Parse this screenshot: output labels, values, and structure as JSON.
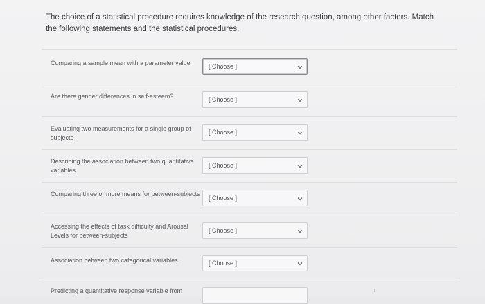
{
  "question": {
    "prompt": "The choice of a statistical procedure requires knowledge of the research question, among other factors. Match the following statements and the statistical procedures."
  },
  "rows": [
    {
      "label": "Comparing a sample mean with a parameter value",
      "value": "[ Choose ]"
    },
    {
      "label": "Are there gender differences in self-esteem?",
      "value": "[ Choose ]"
    },
    {
      "label": "Evaluating two measurements for a single group of subjects",
      "value": "[ Choose ]"
    },
    {
      "label": "Describing the association between two quantitative variables",
      "value": "[ Choose ]"
    },
    {
      "label": "Comparing three or more means for between-subjects",
      "value": "[ Choose ]"
    },
    {
      "label": "Accessing the effects of task difficulty and Arousal Levels for between-subjects",
      "value": "[ Choose ]"
    },
    {
      "label": "Association between two categorical variables",
      "value": "[ Choose ]"
    },
    {
      "label": "Predicting a quantitative response variable from",
      "value": ""
    }
  ],
  "icons": {
    "dropdown": "chevron-down-icon"
  },
  "colors": {
    "page_bg": "#f3f3f4",
    "text": "#3a3a3c",
    "muted_text": "#5a5a5e",
    "border": "#cfd0d3",
    "active_border": "#8a8b8f"
  }
}
